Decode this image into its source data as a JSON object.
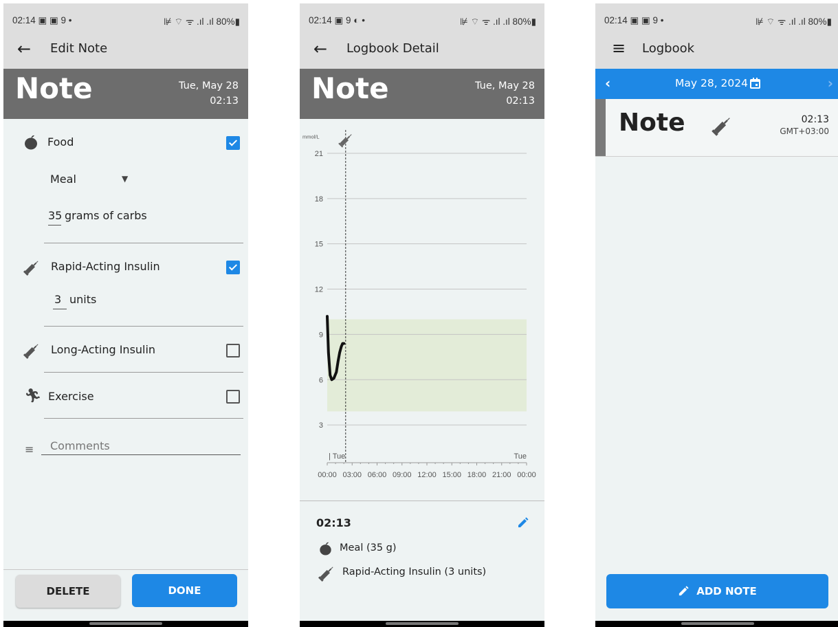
{
  "status": {
    "p1": {
      "time": "02:14 ▣ ▣ 9 •",
      "right": "⊯ ⌔ ᯤ .ıl .ıl 80%▮"
    },
    "p2": {
      "time": "02:14 ▣ 9 ◐ •",
      "right": "⊯ ⌔ ᯤ .ıl .ıl 80%▮"
    },
    "p3": {
      "time": "02:14 ▣ ▣ 9 •",
      "right": "⊯ ⌔ ᯤ .ıl .ıl 80%▮"
    }
  },
  "edit_note": {
    "title": "Edit Note",
    "banner_title": "Note",
    "banner_date": "Tue, May 28",
    "banner_time": "02:13",
    "food_label": "Food",
    "food_checked": true,
    "meal_value": "Meal",
    "carbs_value": "35",
    "carbs_unit": "grams of carbs",
    "rapid_label": "Rapid-Acting Insulin",
    "rapid_checked": true,
    "units_value": "3",
    "units_unit": "units",
    "long_label": "Long-Acting Insulin",
    "long_checked": false,
    "exercise_label": "Exercise",
    "exercise_checked": false,
    "comments_placeholder": "Comments",
    "delete_label": "DELETE",
    "done_label": "DONE"
  },
  "logbook_detail": {
    "title": "Logbook Detail",
    "banner_title": "Note",
    "banner_date": "Tue, May 28",
    "banner_time": "02:13",
    "entry_time": "02:13",
    "entry_meal": "Meal (35 g)",
    "entry_insulin": "Rapid-Acting Insulin (3 units)"
  },
  "chart_data": {
    "type": "line",
    "title": "",
    "xlabel": "",
    "ylabel": "mmol/L",
    "y_ticks": [
      3,
      6,
      9,
      12,
      15,
      18,
      21
    ],
    "ylim": [
      0,
      22
    ],
    "x_ticks": [
      "00:00",
      "03:00",
      "06:00",
      "09:00",
      "12:00",
      "15:00",
      "18:00",
      "21:00",
      "00:00"
    ],
    "day_labels": [
      "Tue",
      "Tue"
    ],
    "target_range": [
      3.9,
      10.0
    ],
    "marker_time_hours": 2.217,
    "series": [
      {
        "x_hours": [
          0.0,
          0.15,
          0.35,
          0.55,
          0.8,
          1.1,
          1.3,
          1.5,
          1.7,
          1.85,
          2.0
        ],
        "values": [
          10.2,
          7.8,
          6.3,
          6.0,
          6.1,
          6.5,
          7.2,
          7.8,
          8.2,
          8.4,
          8.4
        ]
      }
    ]
  },
  "logbook": {
    "title": "Logbook",
    "date": "May 28, 2024",
    "entry_title": "Note",
    "entry_time": "02:13",
    "entry_tz": "GMT+03:00",
    "add_note_label": "ADD NOTE"
  },
  "colors": {
    "accent": "#1e88e5",
    "banner": "#6d6d6d",
    "bar": "#dedede",
    "range": "#e3ecd8"
  }
}
